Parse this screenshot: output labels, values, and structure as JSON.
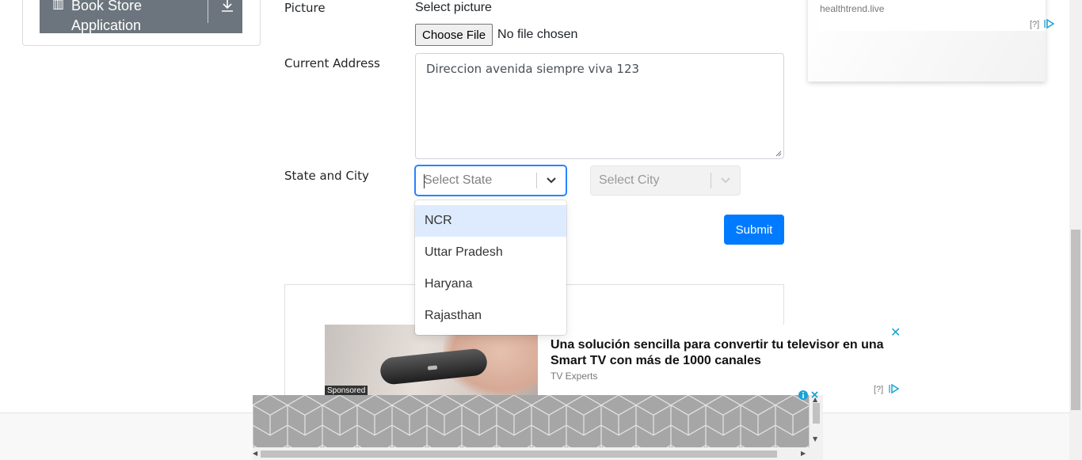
{
  "sidebar": {
    "item_label": "Book Store\nApplication",
    "book_icon": "book-icon",
    "download_icon": "download-icon"
  },
  "form": {
    "picture_label": "Picture",
    "picture_hint": "Select picture",
    "choose_file_label": "Choose File",
    "file_status": "No file chosen",
    "address_label": "Current Address",
    "address_value": "Direccion avenida siempre viva 123",
    "state_city_label": "State and City",
    "state_placeholder": "Select State",
    "city_placeholder": "Select City",
    "state_options": [
      "NCR",
      "Uttar Pradesh",
      "Haryana",
      "Rajasthan"
    ],
    "highlighted_option": "NCR",
    "submit_label": "Submit",
    "accent_color": "#007bff",
    "focus_color": "#2684ff"
  },
  "ads": {
    "top_domain": "healthtrend.live",
    "top_choices": "[?]",
    "mid_title": "Una solución sencilla para convertir tu televisor en una Smart TV con más de 1000 canales",
    "mid_brand": "TV Experts",
    "mid_sponsored": "Sponsored",
    "mid_choices": "[?]",
    "mid_close": "✕",
    "ad_link_color": "#19a2d6"
  }
}
